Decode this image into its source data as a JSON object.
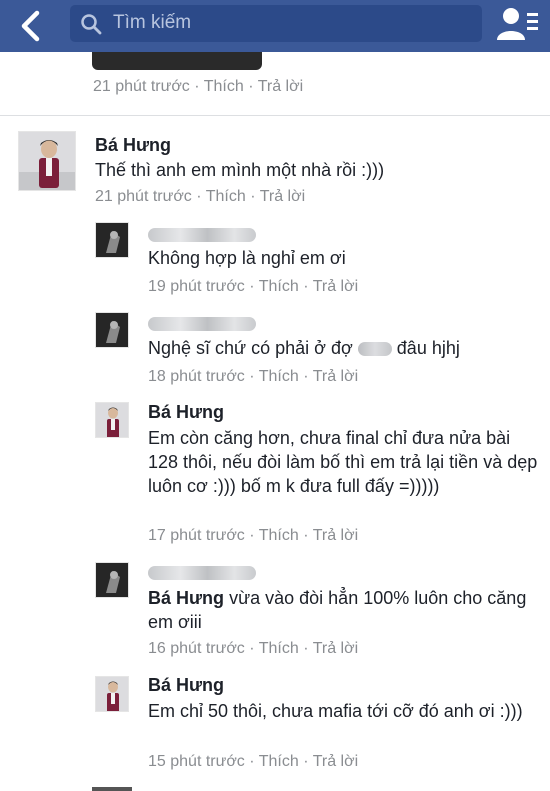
{
  "header": {
    "search_placeholder": "Tìm kiếm",
    "bar_color": "#3b5998",
    "icons": {
      "back": "chevron-left-icon",
      "search": "search-icon",
      "friends": "friend-requests-icon"
    }
  },
  "partial_comment": {
    "time": "21 phút trước",
    "like": "Thích",
    "reply": "Trả lời"
  },
  "comment": {
    "author": "Bá Hưng",
    "text": "Thế thì anh em mình một nhà rồi :)))",
    "time": "21 phút trước",
    "like": "Thích",
    "reply": "Trả lời",
    "sep": "·"
  },
  "replies": [
    {
      "author_blurred": true,
      "text": "Không hợp là nghỉ em ơi",
      "time": "19 phút trước",
      "like": "Thích",
      "reply": "Trả lời"
    },
    {
      "author_blurred": true,
      "text_before": "Nghệ sĩ chứ có phải ở đợ",
      "text_after": "đâu hjhj",
      "time": "18 phút trước",
      "like": "Thích",
      "reply": "Trả lời"
    },
    {
      "author": "Bá Hưng",
      "text": "Em còn căng hơn, chưa final chỉ đưa nửa bài 128 thôi, nếu đòi làm bố thì em trả lại tiền và dẹp luôn cơ :))) bố m k đưa full đấy =)))))",
      "time": "17 phút trước",
      "like": "Thích",
      "reply": "Trả lời"
    },
    {
      "author_blurred": true,
      "tag": "Bá Hưng",
      "text": "vừa vào đòi hẳn 100% luôn cho căng em ơiii",
      "time": "16 phút trước",
      "like": "Thích",
      "reply": "Trả lời"
    },
    {
      "author": "Bá Hưng",
      "text": "Em chỉ 50 thôi, chưa mafia tới cỡ đó anh ơi :)))",
      "time": "15 phút trước",
      "like": "Thích",
      "reply": "Trả lời"
    }
  ]
}
